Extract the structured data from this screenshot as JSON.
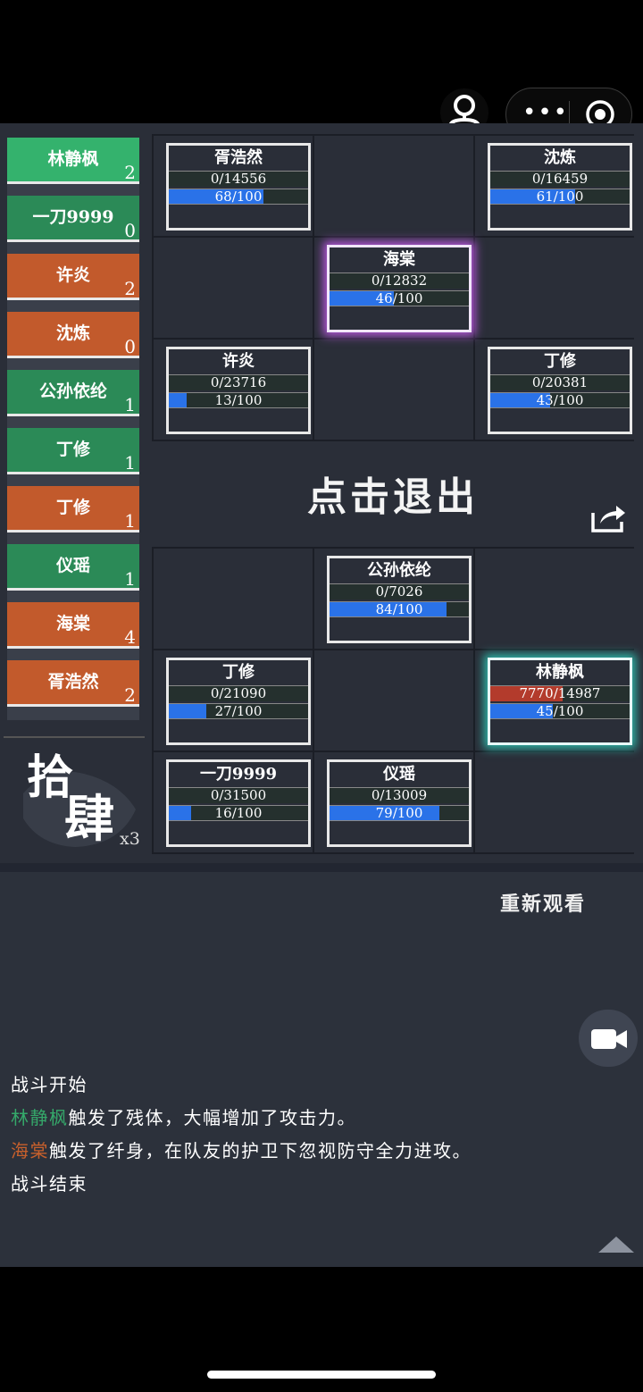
{
  "top_bar": {
    "more_label": "•••"
  },
  "sidebar": [
    {
      "name": "林静枫",
      "count": "2",
      "team": "green"
    },
    {
      "name": "一刀9999",
      "count": "0",
      "team": "green"
    },
    {
      "name": "许炎",
      "count": "2",
      "team": "orange"
    },
    {
      "name": "沈炼",
      "count": "0",
      "team": "orange"
    },
    {
      "name": "公孙依纶",
      "count": "1",
      "team": "green"
    },
    {
      "name": "丁修",
      "count": "1",
      "team": "green"
    },
    {
      "name": "丁修",
      "count": "1",
      "team": "orange"
    },
    {
      "name": "仪瑶",
      "count": "1",
      "team": "green"
    },
    {
      "name": "海棠",
      "count": "4",
      "team": "orange"
    },
    {
      "name": "胥浩然",
      "count": "2",
      "team": "orange"
    }
  ],
  "logo": {
    "text1": "拾",
    "text2": "肆",
    "multiplier": "x3"
  },
  "enemy_cards": [
    {
      "name": "胥浩然",
      "hp": "0/14556",
      "hp_ratio": 0,
      "energy": "68/100",
      "energy_ratio": 0.68
    },
    {
      "name": "沈炼",
      "hp": "0/16459",
      "hp_ratio": 0,
      "energy": "61/100",
      "energy_ratio": 0.61
    },
    {
      "name": "海棠",
      "hp": "0/12832",
      "hp_ratio": 0,
      "energy": "46/100",
      "energy_ratio": 0.46
    },
    {
      "name": "许炎",
      "hp": "0/23716",
      "hp_ratio": 0,
      "energy": "13/100",
      "energy_ratio": 0.13
    },
    {
      "name": "丁修",
      "hp": "0/20381",
      "hp_ratio": 0,
      "energy": "43/100",
      "energy_ratio": 0.43
    }
  ],
  "exit_label": "点击退出",
  "ally_cards": [
    {
      "name": "公孙依纶",
      "hp": "0/7026",
      "hp_ratio": 0,
      "energy": "84/100",
      "energy_ratio": 0.84
    },
    {
      "name": "丁修",
      "hp": "0/21090",
      "hp_ratio": 0,
      "energy": "27/100",
      "energy_ratio": 0.27
    },
    {
      "name": "林静枫",
      "hp": "7770/14987",
      "hp_ratio": 0.518,
      "energy": "45/100",
      "energy_ratio": 0.45
    },
    {
      "name": "一刀9999",
      "hp": "0/31500",
      "hp_ratio": 0,
      "energy": "16/100",
      "energy_ratio": 0.16
    },
    {
      "name": "仪瑶",
      "hp": "0/13009",
      "hp_ratio": 0,
      "energy": "79/100",
      "energy_ratio": 0.79
    }
  ],
  "replay_label": "重新观看",
  "log": {
    "line1": "战斗开始",
    "line2_name": "林静枫",
    "line2_text": "触发了残体，大幅增加了攻击力。",
    "line3_name": "海棠",
    "line3_text": "触发了纤身，在队友的护卫下忽视防守全力进攻。",
    "line4": "战斗结束"
  }
}
